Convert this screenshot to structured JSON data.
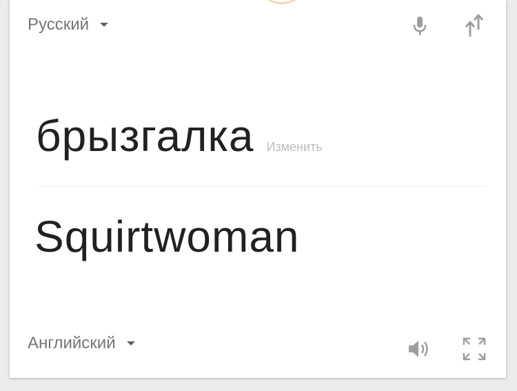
{
  "source": {
    "language": "Русский",
    "text": "брызгалка",
    "edit_label": "Изменить"
  },
  "translation": {
    "language": "Английский",
    "text": "Squirtwoman"
  },
  "icons": {
    "mic": "microphone-icon",
    "swap": "swap-languages-icon",
    "speaker": "speaker-icon",
    "fullscreen": "fullscreen-icon",
    "dropdown": "chevron-down-icon"
  },
  "colors": {
    "icon": "#9e9e9e",
    "text": "#212121",
    "muted": "#757575",
    "edit": "#bdbdbd"
  }
}
